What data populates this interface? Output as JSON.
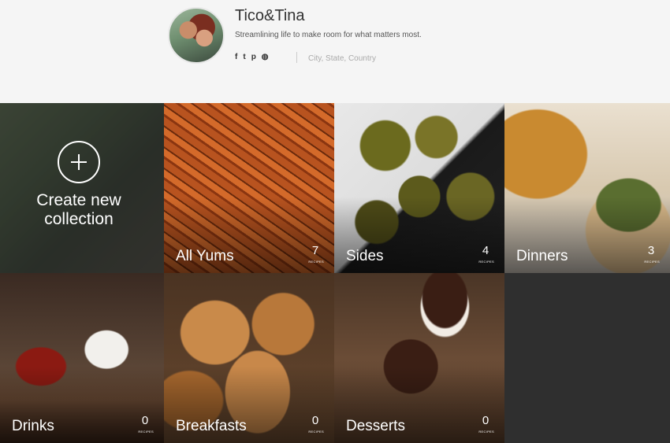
{
  "profile": {
    "name": "Tico&Tina",
    "tagline": "Streamlining life to make room for what matters most.",
    "socials": [
      {
        "icon": "facebook-icon",
        "glyph": "f"
      },
      {
        "icon": "twitter-icon",
        "glyph": "t"
      },
      {
        "icon": "pinterest-icon",
        "glyph": "p"
      },
      {
        "icon": "globe-icon",
        "glyph": "◍"
      }
    ],
    "location": "City, State, Country"
  },
  "create": {
    "label": "Create new collection",
    "icon": "plus-circle-icon"
  },
  "collections": [
    {
      "name": "All Yums",
      "count": "7",
      "unit": "recipes"
    },
    {
      "name": "Sides",
      "count": "4",
      "unit": "recipes"
    },
    {
      "name": "Dinners",
      "count": "3",
      "unit": "recipes"
    },
    {
      "name": "Drinks",
      "count": "0",
      "unit": "recipes"
    },
    {
      "name": "Breakfasts",
      "count": "0",
      "unit": "recipes"
    },
    {
      "name": "Desserts",
      "count": "0",
      "unit": "recipes"
    }
  ]
}
